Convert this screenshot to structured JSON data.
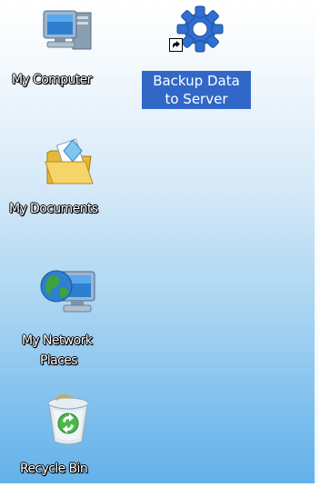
{
  "desktop": {
    "icons": [
      {
        "label": "My Computer",
        "icon": "my-computer-icon"
      },
      {
        "label": "Backup Data",
        "label_line2": "to Server",
        "icon": "gear-icon",
        "selected": true,
        "shortcut": true
      },
      {
        "label": "My Documents",
        "icon": "folder-documents-icon"
      },
      {
        "label": "My Network",
        "label_line2": "Places",
        "icon": "network-places-icon"
      },
      {
        "label": "Recycle Bin",
        "icon": "recycle-bin-icon"
      }
    ],
    "selection_color": "#3168c8",
    "background_top": "#ffffff",
    "background_bottom": "#62b1ea"
  }
}
